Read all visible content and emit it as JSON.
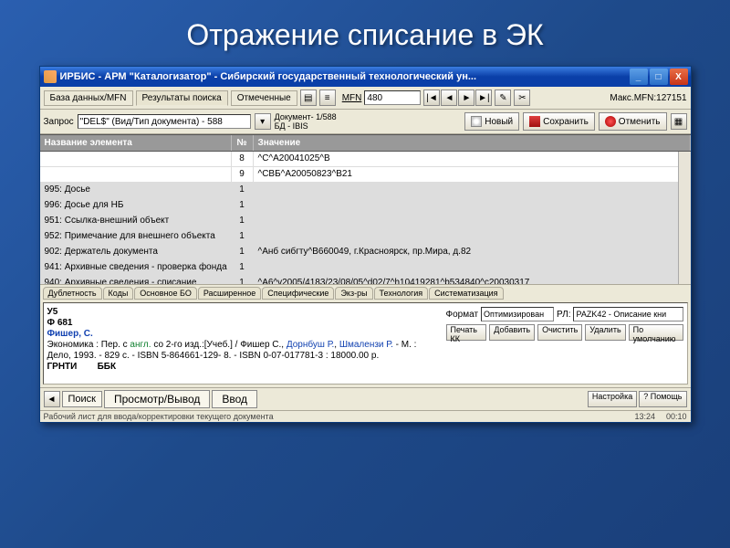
{
  "slide_title": "Отражение списание в ЭК",
  "window": {
    "title": "ИРБИС - АРМ \"Каталогизатор\" - Сибирский государственный технологический ун...",
    "min": "_",
    "max": "□",
    "close": "X"
  },
  "toolbar1": {
    "tab_db": "База данных/MFN",
    "tab_results": "Результаты поиска",
    "tab_marked": "Отмеченные",
    "mfn_label": "MFN",
    "mfn_value": "480",
    "nav_first": "|◄",
    "nav_prev": "◄",
    "nav_next": "►",
    "nav_last": "►|",
    "maxmfn": "Макс.MFN:127151"
  },
  "toolbar2": {
    "query_label": "Запрос",
    "query_value": "\"DEL$\" (Вид/Тип документа) - 588",
    "doc_info_line1": "Документ- 1/588",
    "doc_info_line2": "БД -  IBIS",
    "btn_new": "Новый",
    "btn_save": "Сохранить",
    "btn_cancel": "Отменить"
  },
  "grid": {
    "col_name": "Название элемента",
    "col_num": "№",
    "col_val": "Значение",
    "rows": [
      {
        "name": "",
        "num": "8",
        "val": "^С^А20041025^В"
      },
      {
        "name": "",
        "num": "9",
        "val": "^СВБ^А20050823^В21"
      },
      {
        "name": "995: Досье",
        "num": "1",
        "val": ""
      },
      {
        "name": "996: Досье для НБ",
        "num": "1",
        "val": ""
      },
      {
        "name": "951: Ссылка-внешний объект",
        "num": "1",
        "val": ""
      },
      {
        "name": "952: Примечание для внешнего объекта",
        "num": "1",
        "val": ""
      },
      {
        "name": "902: Держатель документа",
        "num": "1",
        "val": "^Анб сибгту^В660049, г.Красноярск, пр.Мира, д.82"
      },
      {
        "name": "941: Архивные сведения - проверка фонда",
        "num": "1",
        "val": ""
      },
      {
        "name": "940: Архивные сведения - списание",
        "num": "1",
        "val": "^А6^v2005/4183/23/08/05^d02/7^h10419281^b534840^c20030317"
      }
    ]
  },
  "sub_tabs": [
    "Дублетность",
    "Коды",
    "Основное БО",
    "Расширенное",
    "Специфические",
    "Экз-ры",
    "Технология",
    "Систематизация"
  ],
  "preview": {
    "code1": "У5",
    "code2": "Ф 681",
    "author": "Фишер, С.",
    "body": "    Экономика : Пер. с англ. со 2-го изд.:[Учеб.] / Фишер С., Дорнбуш Р., Шмалензи Р. - М. : Дело, 1993. - 829 с. - ISBN 5-864661-129- 8. - ISBN 0-07-017781-3 : 18000.00 р.",
    "grnti_label": "ГРНТИ",
    "bbk_label": "ББК"
  },
  "side": {
    "format_label": "Формат",
    "format_value": "Оптимизирован",
    "rl_label": "РЛ:",
    "rl_value": "PAZK42 - Описание кни",
    "btn_print": "Печать КК",
    "btn_add": "Добавить",
    "btn_clear": "Очистить",
    "btn_delete": "Удалить",
    "btn_default": "По умолчанию"
  },
  "bottom_tabs": {
    "search": "Поиск",
    "view": "Просмотр/Вывод",
    "input": "Ввод",
    "settings": "Настройка",
    "help": "? Помощь"
  },
  "status": {
    "hint": "Рабочий лист для ввода/корректировки текущего документа",
    "time": "13:24",
    "date": "00:10"
  }
}
